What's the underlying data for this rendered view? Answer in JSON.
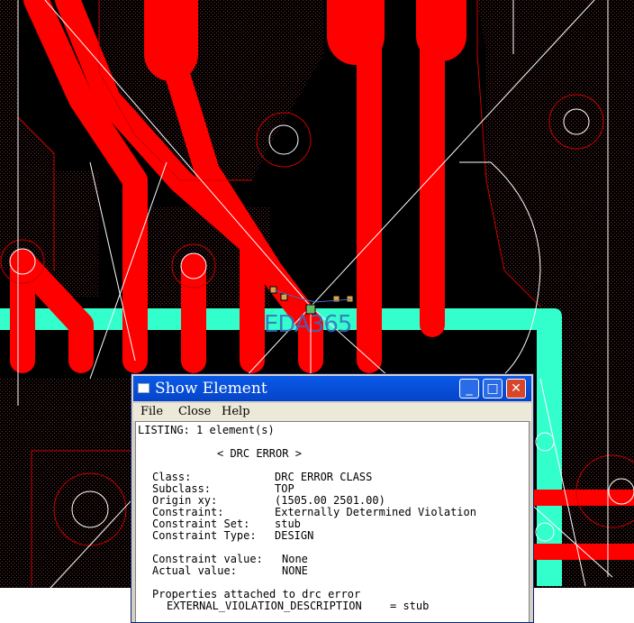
{
  "window": {
    "title": "Show Element",
    "buttons": {
      "minimize": "_",
      "maximize": "□",
      "close": "✕"
    }
  },
  "menu": {
    "file": "File",
    "close": "Close",
    "help": "Help"
  },
  "listing": {
    "header": "LISTING: 1 element(s)",
    "section": "< DRC ERROR >",
    "fields": [
      {
        "label": "Class:",
        "value": "DRC ERROR CLASS"
      },
      {
        "label": "Subclass:",
        "value": "TOP"
      },
      {
        "label": "Origin xy:",
        "value": "(1505.00 2501.00)"
      },
      {
        "label": "Constraint:",
        "value": "Externally Determined Violation"
      },
      {
        "label": "Constraint Set:",
        "value": "stub"
      },
      {
        "label": "Constraint Type:",
        "value": "DESIGN"
      }
    ],
    "values": [
      {
        "label": "Constraint value:",
        "value": "None"
      },
      {
        "label": "Actual value:",
        "value": "NONE"
      }
    ],
    "properties_header": "Properties attached to drc error",
    "property": {
      "name": "EXTERNAL_VIOLATION_DESCRIPTION",
      "value": "= stub"
    }
  },
  "watermark": "EDA365",
  "colors": {
    "trace": "#ff0000",
    "shape": "#33ffcc",
    "board": "#2a0a0a",
    "titlebar": "#0a5ae8"
  }
}
